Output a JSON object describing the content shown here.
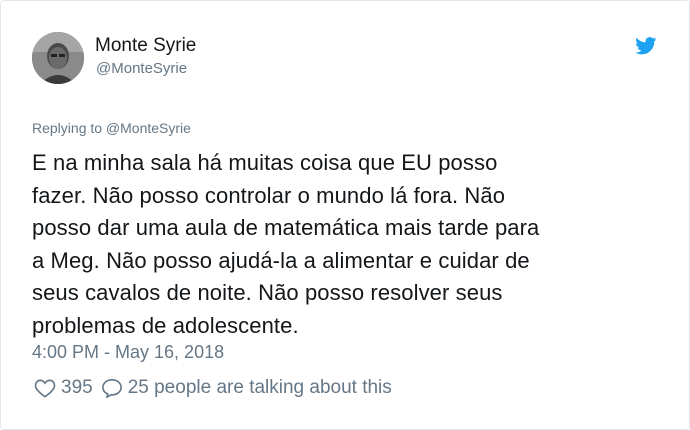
{
  "tweet": {
    "author": {
      "display_name": "Monte Syrie",
      "handle": "@MonteSyrie"
    },
    "reply_to": "Replying to @MonteSyrie",
    "text_lines": [
      "E na minha sala há muitas coisa que EU posso",
      "fazer. Não posso controlar o mundo lá fora. Não",
      "posso dar uma aula de matemática mais tarde para",
      "a Meg. Não posso ajudá-la a alimentar e cuidar de",
      "seus cavalos de noite. Não posso resolver seus",
      "problemas de adolescente."
    ],
    "timestamp": "4:00 PM - May 16, 2018",
    "likes": "395",
    "conversation": "25 people are talking about this"
  },
  "icons": {
    "brand": "twitter-bird-icon",
    "like": "heart-icon",
    "reply": "speech-bubble-icon"
  },
  "colors": {
    "twitter_blue": "#1da1f2",
    "secondary_text": "#657786",
    "primary_text": "#14171a",
    "border": "#e1e8ed"
  }
}
